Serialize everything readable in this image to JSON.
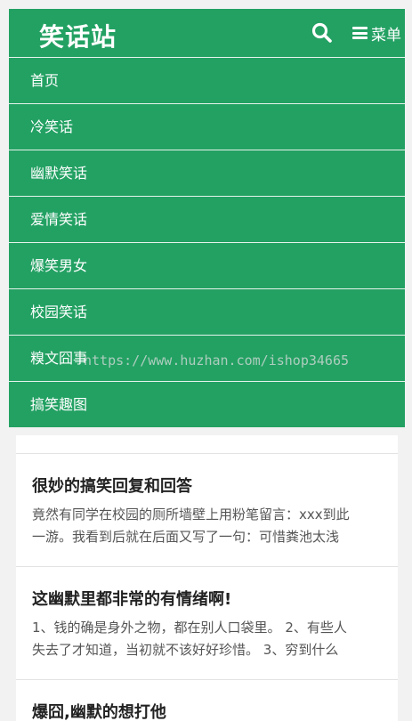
{
  "header": {
    "logo": "笑话站",
    "search_icon": "search-icon",
    "menu_icon": "hamburger-icon",
    "menu_label": "菜单"
  },
  "nav": {
    "items": [
      {
        "label": "首页"
      },
      {
        "label": "冷笑话"
      },
      {
        "label": "幽默笑话"
      },
      {
        "label": "爱情笑话"
      },
      {
        "label": "爆笑男女"
      },
      {
        "label": "校园笑话"
      },
      {
        "label": "糗文囧事"
      },
      {
        "label": "搞笑趣图"
      }
    ]
  },
  "articles": [
    {
      "title": "很妙的搞笑回复和回答",
      "excerpt_line1": "竟然有同学在校园的厕所墙壁上用粉笔留言：xxx到此",
      "excerpt_line2": "一游。我看到后就在后面又写了一句：可惜粪池太浅"
    },
    {
      "title": "这幽默里都非常的有情绪啊!",
      "excerpt_line1": "1、钱的确是身外之物，都在别人口袋里。 2、有些人",
      "excerpt_line2": "失去了才知道，当初就不该好好珍惜。 3、穷到什么"
    },
    {
      "title": "爆囧,幽默的想打他"
    }
  ],
  "watermark": "https://www.huzhan.com/ishop34665",
  "colors": {
    "brand_green": "#23a163",
    "page_bg": "#f2f2f2"
  }
}
